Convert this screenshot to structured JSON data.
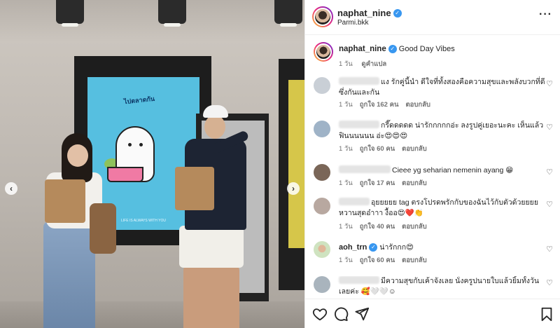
{
  "header": {
    "username": "naphat_nine",
    "location": "Parmi.bkk"
  },
  "caption": {
    "username": "naphat_nine",
    "text": "Good Day Vibes",
    "time": "1 วัน",
    "translate": "ดูคำแปล"
  },
  "comments": [
    {
      "text": "แง รักคู่นี้นำ ดีใจที่ทั้งสองคือความสุขและพลังบวกที่ดีซึ่งกันและกัน",
      "time": "1 วัน",
      "likes": "ถูกใจ 162 คน",
      "reply": "ตอบกลับ"
    },
    {
      "text": "กรี๊ดดดดด น่ารักกกกกอ่ะ ลงรูปคู่เยอะนะคะ เห็นแล้วฟินนนนนน อ่ะ😍😍😍",
      "time": "1 วัน",
      "likes": "ถูกใจ 60 คน",
      "reply": "ตอบกลับ"
    },
    {
      "text": "Cieee yg seharian nemenin ayang 😁",
      "time": "1 วัน",
      "likes": "ถูกใจ 17 คน",
      "reply": "ตอบกลับ"
    },
    {
      "text": "อุยยยยย tag ตรงโปรดพรักกับของฉันไว้กับตัวด้วยยยย หวานสุดอ๋าาา งื้ออ😍❤️👏",
      "time": "1 วัน",
      "likes": "ถูกใจ 40 คน",
      "reply": "ตอบกลับ"
    },
    {
      "username": "aoh_trn",
      "text": "น่ารักกก😍",
      "time": "1 วัน",
      "likes": "ถูกใจ 60 คน",
      "reply": "ตอบกลับ"
    },
    {
      "text": "มีความสุขกับเค้าจังเลย นั่งครูปนายใบแล้วยิ้มทั้งวันเลยค่ะ 🥰🤍🤍☺",
      "time": "",
      "likes": "",
      "reply": ""
    }
  ],
  "poster": {
    "title": "ไปตลาดกัน",
    "note": "LIFE IS ALWAYS WITH YOU"
  },
  "icons": {
    "more": "more-options-icon",
    "like": "heart-icon",
    "comment": "comment-bubble-icon",
    "share": "paper-plane-icon",
    "save": "bookmark-icon",
    "prev": "chevron-left-icon",
    "next": "chevron-right-icon"
  },
  "colors": {
    "verified": "#3897f0",
    "text": "#262626",
    "meta": "#737373",
    "border": "#efefef"
  }
}
